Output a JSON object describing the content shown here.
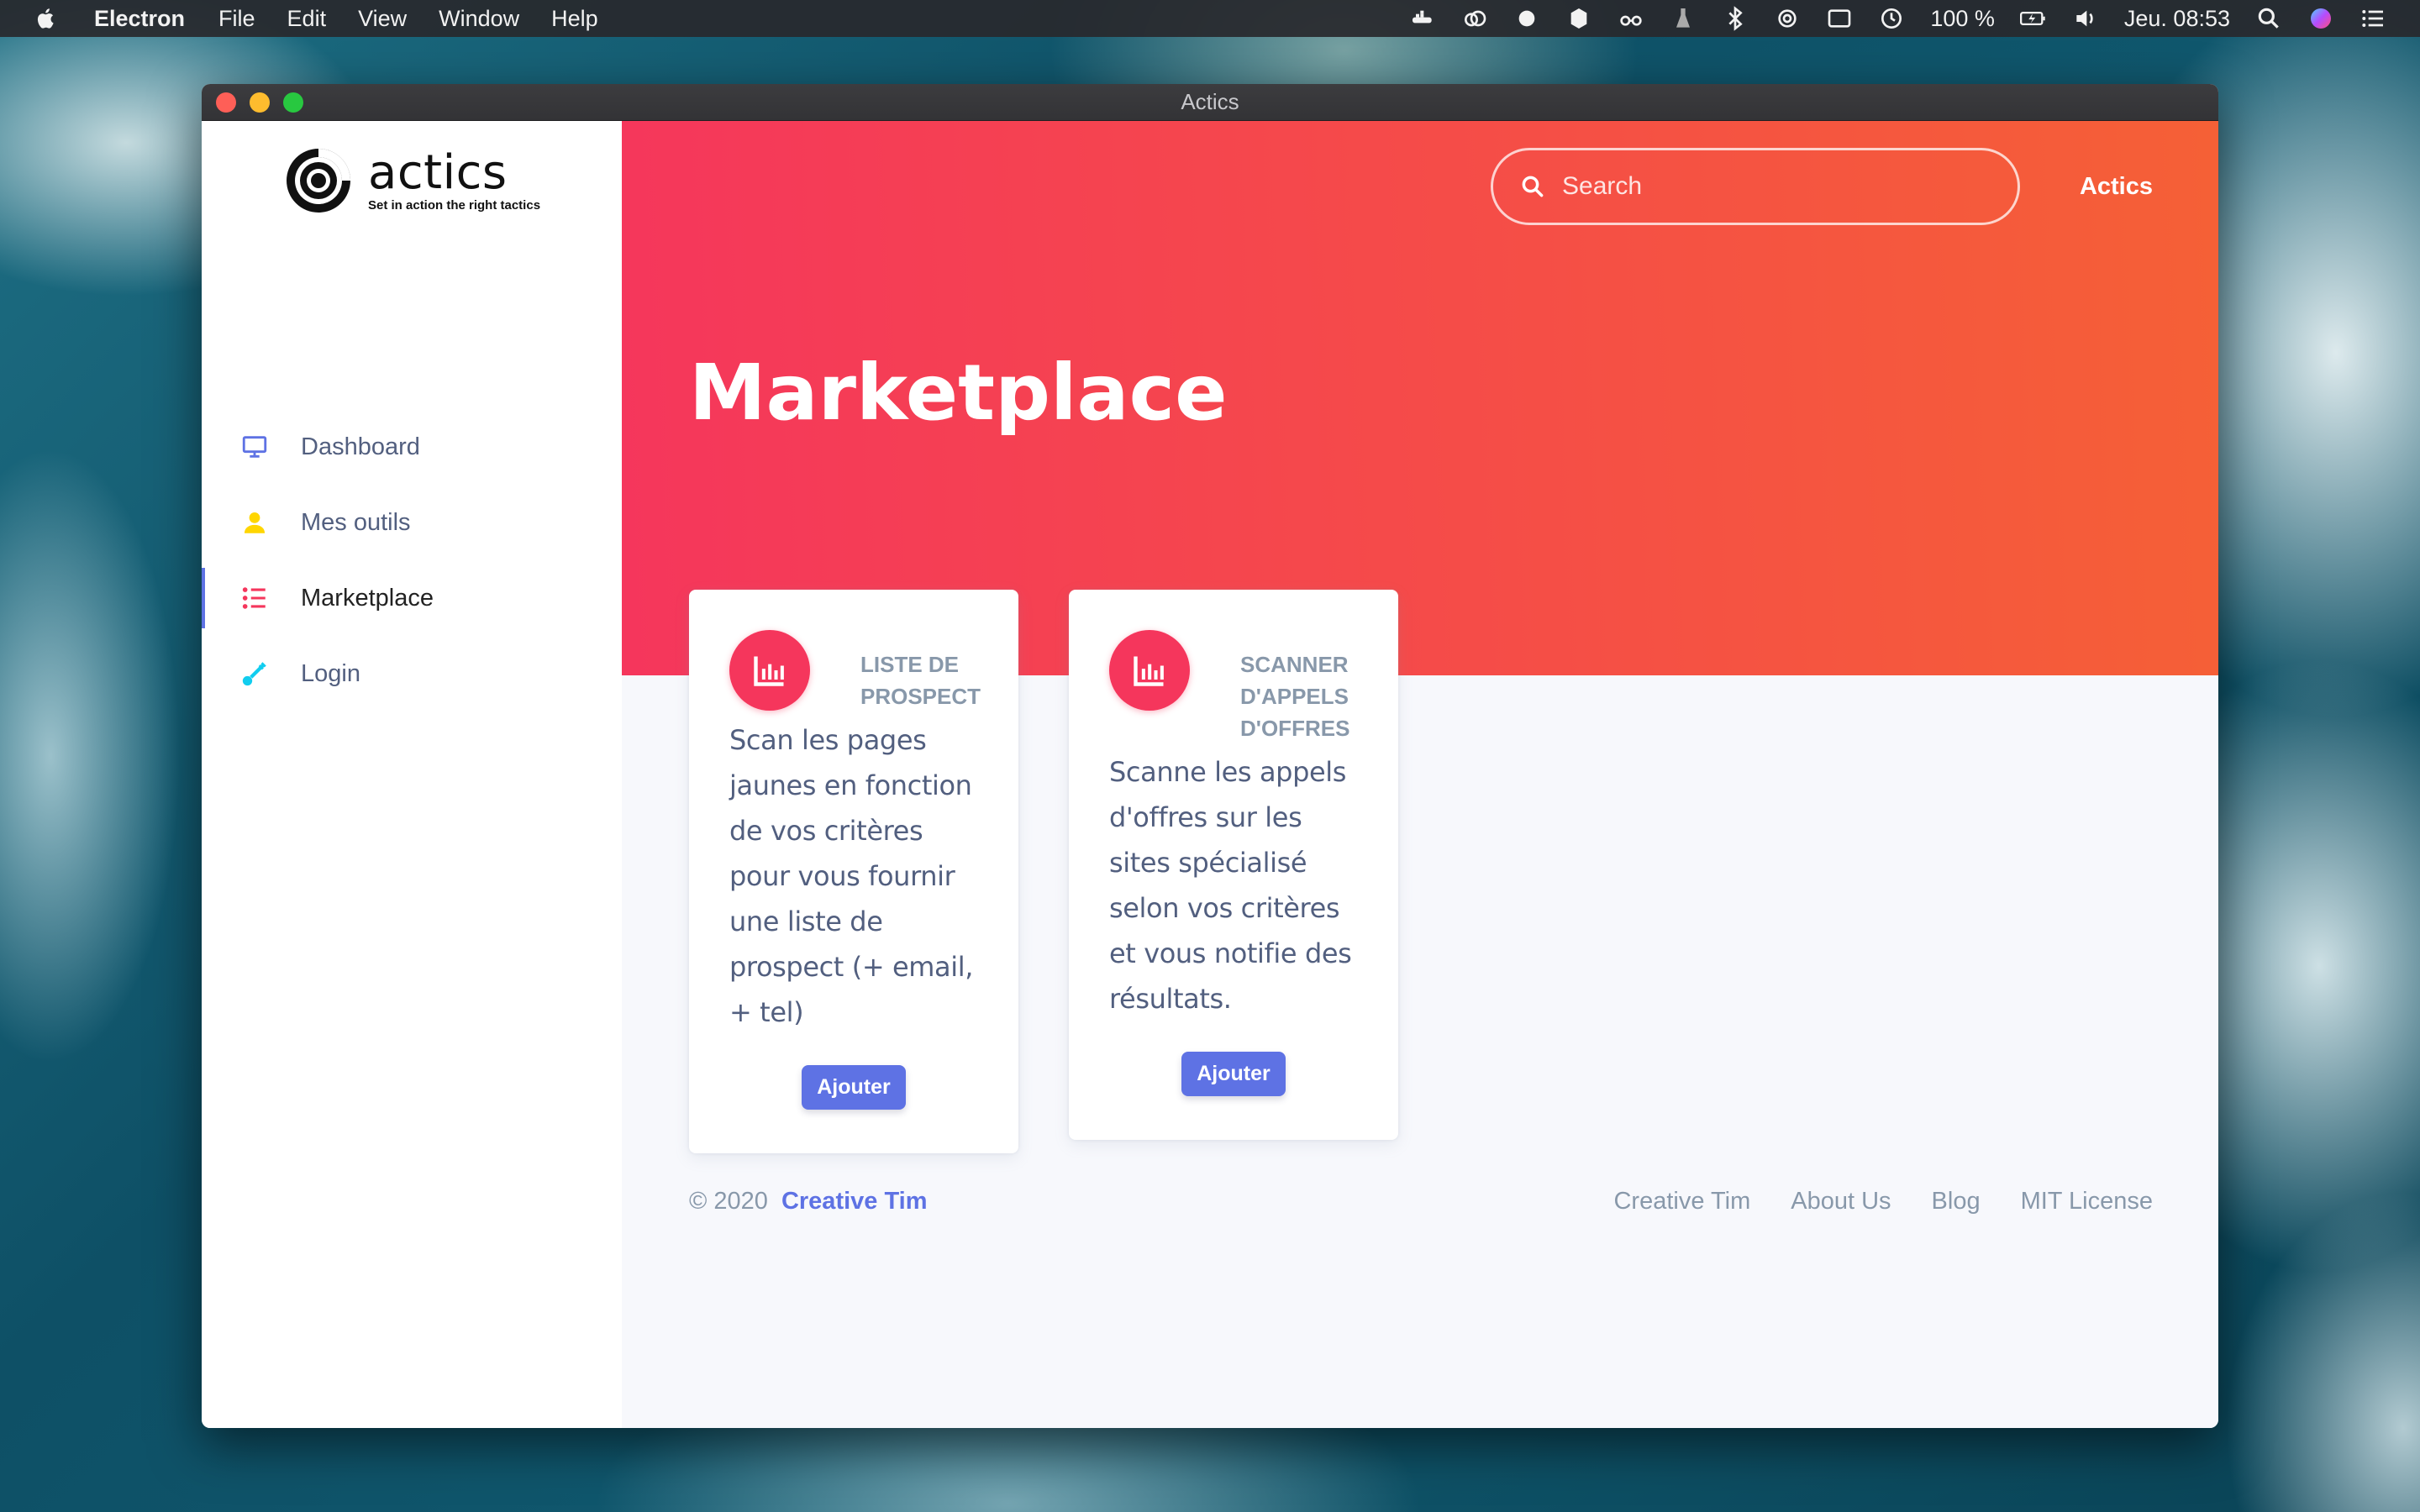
{
  "menubar": {
    "app_name": "Electron",
    "menus": [
      "File",
      "Edit",
      "View",
      "Window",
      "Help"
    ],
    "battery": "100 %",
    "clock": "Jeu. 08:53"
  },
  "window": {
    "title": "Actics"
  },
  "sidebar": {
    "logo_word": "actics",
    "logo_tagline": "Set in action the right tactics",
    "items": [
      {
        "label": "Dashboard",
        "icon": "monitor-icon",
        "color": "#5e72e4"
      },
      {
        "label": "Mes outils",
        "icon": "user-icon",
        "color": "#ffd600"
      },
      {
        "label": "Marketplace",
        "icon": "list-icon",
        "color": "#f5365c",
        "active": true
      },
      {
        "label": "Login",
        "icon": "key-icon",
        "color": "#11cdef"
      }
    ]
  },
  "header": {
    "search_placeholder": "Search",
    "user_link": "Actics"
  },
  "page": {
    "title": "Marketplace"
  },
  "cards": [
    {
      "icon": "chart-bar-icon",
      "title": "LISTE DE PROSPECT",
      "description": "Scan les pages jaunes en fonction de vos critères pour vous fournir une liste de prospect (+ email, + tel)",
      "button": "Ajouter"
    },
    {
      "icon": "chart-bar-icon",
      "title": "SCANNER D'APPELS D'OFFRES",
      "description": "Scanne les appels d'offres sur les sites spécialisé selon vos critères et vous notifie des résultats.",
      "button": "Ajouter"
    }
  ],
  "footer": {
    "copyright": "© 2020",
    "copyright_link": "Creative Tim",
    "links": [
      "Creative Tim",
      "About Us",
      "Blog",
      "MIT License"
    ]
  },
  "colors": {
    "hero_start": "#f5365c",
    "hero_end": "#f56036",
    "primary": "#5e72e4",
    "muted": "#8898aa",
    "text": "#525f7f"
  }
}
